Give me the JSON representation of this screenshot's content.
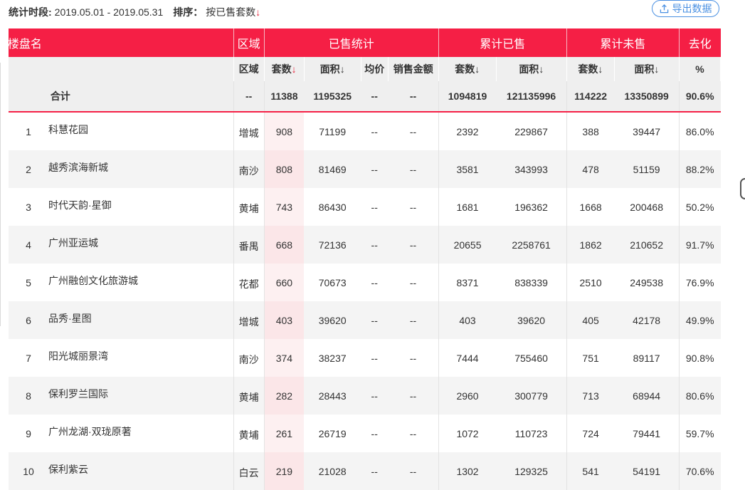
{
  "header": {
    "period_label": "统计时段:",
    "period_value": "2019.05.01 - 2019.05.31",
    "sort_label": "排序：",
    "sort_value": "按已售套数",
    "export_label": "导出数据"
  },
  "table": {
    "group_headers": {
      "name": "楼盘名",
      "district": "区域",
      "sold": "已售统计",
      "cum_sold": "累计已售",
      "cum_unsold": "累计未售",
      "absorption": "去化"
    },
    "sub_headers": {
      "district": "区域",
      "sold_units": "套数",
      "sold_area": "面积",
      "avg_price": "均价",
      "sales_amount": "销售金额",
      "cum_sold_units": "套数",
      "cum_sold_area": "面积",
      "cum_unsold_units": "套数",
      "cum_unsold_area": "面积",
      "absorption_pct": "%"
    },
    "total": {
      "label": "合计",
      "district": "--",
      "sold_units": "11388",
      "sold_area": "1195325",
      "avg_price": "--",
      "sales_amount": "--",
      "cum_sold_units": "1094819",
      "cum_sold_area": "121135996",
      "cum_unsold_units": "114222",
      "cum_unsold_area": "13350899",
      "absorption": "90.6%"
    },
    "rows": [
      {
        "rank": "1",
        "name": "科慧花园",
        "district": "增城",
        "sold_units": "908",
        "sold_area": "71199",
        "avg_price": "--",
        "sales_amount": "--",
        "cum_sold_units": "2392",
        "cum_sold_area": "229867",
        "cum_unsold_units": "388",
        "cum_unsold_area": "39447",
        "absorption": "86.0%"
      },
      {
        "rank": "2",
        "name": "越秀滨海新城",
        "district": "南沙",
        "sold_units": "808",
        "sold_area": "81469",
        "avg_price": "--",
        "sales_amount": "--",
        "cum_sold_units": "3581",
        "cum_sold_area": "343993",
        "cum_unsold_units": "478",
        "cum_unsold_area": "51159",
        "absorption": "88.2%"
      },
      {
        "rank": "3",
        "name": "时代天韵·星御",
        "district": "黄埔",
        "sold_units": "743",
        "sold_area": "86430",
        "avg_price": "--",
        "sales_amount": "--",
        "cum_sold_units": "1681",
        "cum_sold_area": "196362",
        "cum_unsold_units": "1668",
        "cum_unsold_area": "200468",
        "absorption": "50.2%"
      },
      {
        "rank": "4",
        "name": "广州亚运城",
        "district": "番禺",
        "sold_units": "668",
        "sold_area": "72136",
        "avg_price": "--",
        "sales_amount": "--",
        "cum_sold_units": "20655",
        "cum_sold_area": "2258761",
        "cum_unsold_units": "1862",
        "cum_unsold_area": "210652",
        "absorption": "91.7%"
      },
      {
        "rank": "5",
        "name": "广州融创文化旅游城",
        "district": "花都",
        "sold_units": "660",
        "sold_area": "70673",
        "avg_price": "--",
        "sales_amount": "--",
        "cum_sold_units": "8371",
        "cum_sold_area": "838339",
        "cum_unsold_units": "2510",
        "cum_unsold_area": "249538",
        "absorption": "76.9%"
      },
      {
        "rank": "6",
        "name": "品秀·星图",
        "district": "增城",
        "sold_units": "403",
        "sold_area": "39620",
        "avg_price": "--",
        "sales_amount": "--",
        "cum_sold_units": "403",
        "cum_sold_area": "39620",
        "cum_unsold_units": "405",
        "cum_unsold_area": "42178",
        "absorption": "49.9%"
      },
      {
        "rank": "7",
        "name": "阳光城丽景湾",
        "district": "南沙",
        "sold_units": "374",
        "sold_area": "38237",
        "avg_price": "--",
        "sales_amount": "--",
        "cum_sold_units": "7444",
        "cum_sold_area": "755460",
        "cum_unsold_units": "751",
        "cum_unsold_area": "89117",
        "absorption": "90.8%"
      },
      {
        "rank": "8",
        "name": "保利罗兰国际",
        "district": "黄埔",
        "sold_units": "282",
        "sold_area": "28443",
        "avg_price": "--",
        "sales_amount": "--",
        "cum_sold_units": "2960",
        "cum_sold_area": "300779",
        "cum_unsold_units": "713",
        "cum_unsold_area": "68944",
        "absorption": "80.6%"
      },
      {
        "rank": "9",
        "name": "广州龙湖·双珑原著",
        "district": "黄埔",
        "sold_units": "261",
        "sold_area": "26719",
        "avg_price": "--",
        "sales_amount": "--",
        "cum_sold_units": "1072",
        "cum_sold_area": "110723",
        "cum_unsold_units": "724",
        "cum_unsold_area": "79441",
        "absorption": "59.7%"
      },
      {
        "rank": "10",
        "name": "保利紫云",
        "district": "白云",
        "sold_units": "219",
        "sold_area": "21028",
        "avg_price": "--",
        "sales_amount": "--",
        "cum_sold_units": "1302",
        "cum_sold_area": "129325",
        "cum_unsold_units": "541",
        "cum_unsold_area": "54191",
        "absorption": "70.6%"
      }
    ]
  },
  "icons": {
    "sort_arrow": "↓",
    "export": "upload-icon"
  },
  "colors": {
    "header_red": "#f51f45",
    "sort_arrow_red": "#e8243c",
    "export_blue": "#4a90e2"
  }
}
